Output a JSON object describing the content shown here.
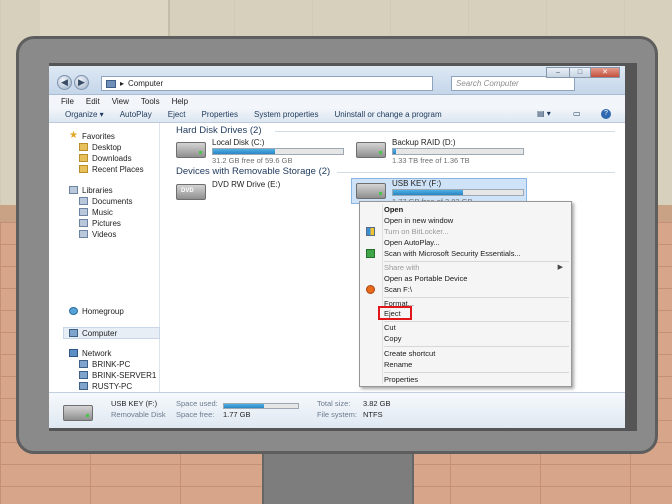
{
  "window": {
    "address": "Computer",
    "search_placeholder": "Search Computer",
    "back_glyph": "◀",
    "forward_glyph": "▶",
    "min_glyph": "–",
    "max_glyph": "□",
    "close_glyph": "✕"
  },
  "menu": [
    "File",
    "Edit",
    "View",
    "Tools",
    "Help"
  ],
  "toolbar": {
    "items": [
      "Organize ▾",
      "AutoPlay",
      "Eject",
      "Properties",
      "System properties",
      "Uninstall or change a program"
    ],
    "view_glyph": "▤ ▾",
    "pane_glyph": "▭",
    "help_glyph": "?"
  },
  "sidebar": {
    "favorites": "Favorites",
    "favorites_items": [
      "Desktop",
      "Downloads",
      "Recent Places"
    ],
    "libraries": "Libraries",
    "libraries_items": [
      "Documents",
      "Music",
      "Pictures",
      "Videos"
    ],
    "homegroup": "Homegroup",
    "computer": "Computer",
    "network": "Network",
    "network_items": [
      "BRINK-PC",
      "BRINK-SERVER1",
      "RUSTY-PC"
    ]
  },
  "content": {
    "hdd_header": "Hard Disk Drives (2)",
    "removable_header": "Devices with Removable Storage (2)",
    "drives": [
      {
        "name": "Local Disk (C:)",
        "free": "31.2 GB free of 59.6 GB",
        "used_fraction": 0.48
      },
      {
        "name": "Backup RAID (D:)",
        "free": "1.33 TB free of 1.36 TB",
        "used_fraction": 0.02
      },
      {
        "name": "DVD RW Drive (E:)"
      },
      {
        "name": "USB KEY (F:)",
        "free": "1.77 GB free of 3.82 GB",
        "used_fraction": 0.54
      }
    ]
  },
  "context_menu": {
    "items": [
      "Open",
      "Open in new window",
      "Turn on BitLocker...",
      "Open AutoPlay...",
      "Scan with Microsoft Security Essentials...",
      "Share with",
      "Open as Portable Device",
      "Scan F:\\",
      "Format...",
      "Eject",
      "Cut",
      "Copy",
      "Create shortcut",
      "Rename",
      "Properties"
    ],
    "submenu_arrow": "▶"
  },
  "details": {
    "name": "USB KEY (F:)",
    "type": "Removable Disk",
    "space_used_label": "Space used:",
    "space_used_fraction": 0.54,
    "space_free_label": "Space free:",
    "space_free_value": "1.77 GB",
    "total_size_label": "Total size:",
    "total_size_value": "3.82 GB",
    "file_system_label": "File system:",
    "file_system_value": "NTFS"
  },
  "colors": {
    "accent": "#2a86c3",
    "eject_highlight": "#e0161b"
  }
}
